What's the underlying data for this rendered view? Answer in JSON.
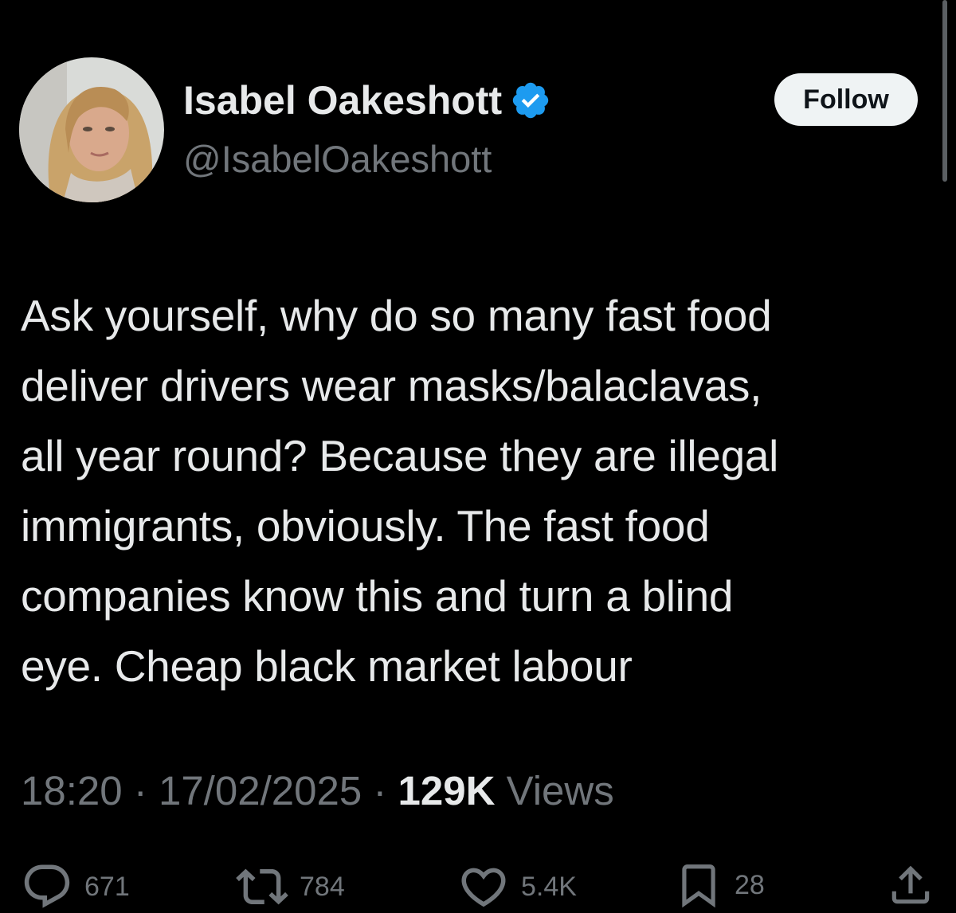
{
  "author": {
    "display_name": "Isabel Oakeshott",
    "handle": "@IsabelOakeshott",
    "verified": true
  },
  "follow_label": "Follow",
  "tweet": {
    "lines": [
      "Ask yourself, why do so many fast food",
      "deliver drivers wear masks/balaclavas,",
      "all year round? Because they are illegal",
      "immigrants, obviously. The fast food",
      "companies know this and turn a blind",
      "eye. Cheap black market labour"
    ]
  },
  "meta": {
    "time": "18:20",
    "separator": "·",
    "date": "17/02/2025",
    "views_count": "129K",
    "views_label": "Views"
  },
  "actions": {
    "replies": "671",
    "reposts": "784",
    "likes": "5.4K",
    "bookmarks": "28"
  },
  "colors": {
    "background": "#000000",
    "primary_text": "#e7e9ea",
    "secondary_text": "#71767b",
    "verified_blue": "#1d9bf0",
    "follow_button": "#eff3f4"
  },
  "icons": {
    "reply": "reply-icon",
    "repost": "repost-icon",
    "like": "heart-icon",
    "bookmark": "bookmark-icon",
    "share": "share-icon",
    "verified": "verified-badge-icon"
  }
}
